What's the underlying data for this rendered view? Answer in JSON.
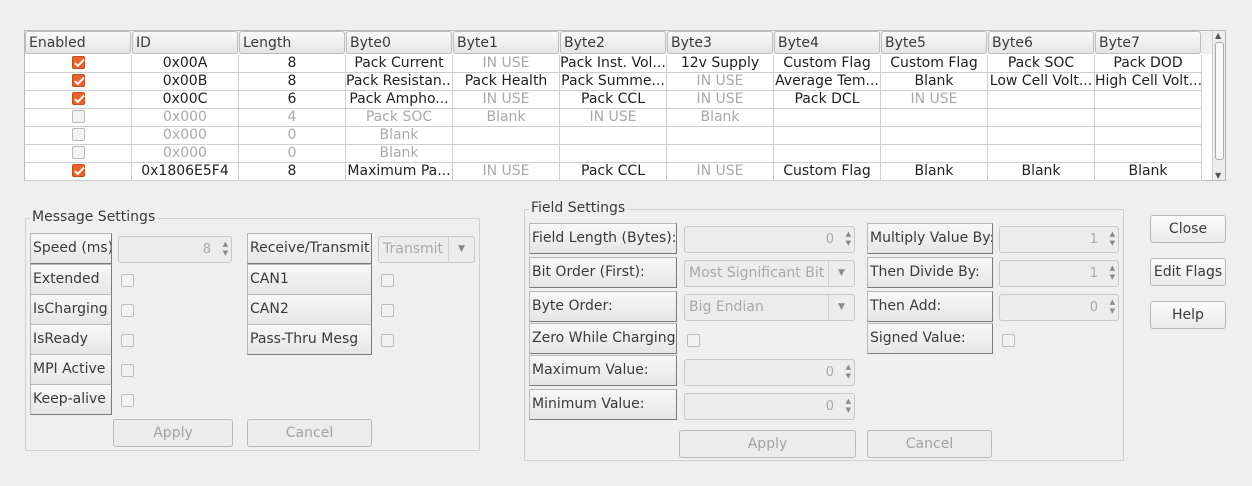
{
  "table": {
    "columns": [
      {
        "label": "Enabled"
      },
      {
        "label": "ID"
      },
      {
        "label": "Length"
      },
      {
        "label": "Byte0"
      },
      {
        "label": "Byte1"
      },
      {
        "label": "Byte2"
      },
      {
        "label": "Byte3"
      },
      {
        "label": "Byte4"
      },
      {
        "label": "Byte5"
      },
      {
        "label": "Byte6"
      },
      {
        "label": "Byte7"
      }
    ],
    "rows": [
      {
        "enabled": true,
        "id": "0x00A",
        "length": "8",
        "bytes": [
          "Pack Current",
          "IN USE",
          "Pack Inst. Vol...",
          "12v Supply",
          "Custom Flag",
          "Custom Flag",
          "Pack SOC",
          "Pack DOD"
        ],
        "dim": [
          false,
          true,
          false,
          false,
          false,
          false,
          false,
          false
        ]
      },
      {
        "enabled": true,
        "id": "0x00B",
        "length": "8",
        "bytes": [
          "Pack Resistan...",
          "Pack Health",
          "Pack Summe...",
          "IN USE",
          "Average Tem...",
          "Blank",
          "Low Cell Volt...",
          "High Cell Volt..."
        ],
        "dim": [
          false,
          false,
          false,
          true,
          false,
          false,
          false,
          false
        ]
      },
      {
        "enabled": true,
        "id": "0x00C",
        "length": "6",
        "bytes": [
          "Pack Ampho...",
          "IN USE",
          "Pack CCL",
          "IN USE",
          "Pack DCL",
          "IN USE",
          "",
          ""
        ],
        "dim": [
          false,
          true,
          false,
          true,
          false,
          true,
          false,
          false
        ]
      },
      {
        "enabled": false,
        "id": "0x000",
        "length": "4",
        "bytes": [
          "Pack SOC",
          "Blank",
          "IN USE",
          "Blank",
          "",
          "",
          "",
          ""
        ],
        "dim": [
          true,
          true,
          true,
          true,
          true,
          true,
          true,
          true
        ]
      },
      {
        "enabled": false,
        "id": "0x000",
        "length": "0",
        "bytes": [
          "Blank",
          "",
          "",
          "",
          "",
          "",
          "",
          ""
        ],
        "dim": [
          true,
          true,
          true,
          true,
          true,
          true,
          true,
          true
        ]
      },
      {
        "enabled": false,
        "id": "0x000",
        "length": "0",
        "bytes": [
          "Blank",
          "",
          "",
          "",
          "",
          "",
          "",
          ""
        ],
        "dim": [
          true,
          true,
          true,
          true,
          true,
          true,
          true,
          true
        ]
      },
      {
        "enabled": true,
        "id": "0x1806E5F4",
        "length": "8",
        "bytes": [
          "Maximum Pa...",
          "IN USE",
          "Pack CCL",
          "IN USE",
          "Custom Flag",
          "Blank",
          "Blank",
          "Blank"
        ],
        "dim": [
          false,
          true,
          false,
          true,
          false,
          false,
          false,
          false
        ]
      }
    ]
  },
  "message_settings": {
    "title": "Message Settings",
    "speed_label": "Speed (ms)",
    "speed_value": "8",
    "extended_label": "Extended",
    "ischarging_label": "IsCharging",
    "isready_label": "IsReady",
    "mpi_active_label": "MPI Active",
    "keep_alive_label": "Keep-alive",
    "receive_transmit_label": "Receive/Transmit",
    "receive_transmit_value": "Transmit",
    "can1_label": "CAN1",
    "can2_label": "CAN2",
    "pass_thru_label": "Pass-Thru Mesg",
    "apply_label": "Apply",
    "cancel_label": "Cancel"
  },
  "field_settings": {
    "title": "Field Settings",
    "field_length_label": "Field Length (Bytes):",
    "field_length_value": "0",
    "bit_order_label": "Bit Order (First):",
    "bit_order_value": "Most Significant Bit",
    "byte_order_label": "Byte Order:",
    "byte_order_value": "Big Endian",
    "zero_while_charging_label": "Zero While Charging:",
    "maximum_value_label": "Maximum Value:",
    "maximum_value": "0",
    "minimum_value_label": "Minimum Value:",
    "minimum_value": "0",
    "multiply_label": "Multiply Value By:",
    "multiply_value": "1",
    "divide_label": "Then Divide By:",
    "divide_value": "1",
    "add_label": "Then Add:",
    "add_value": "0",
    "signed_label": "Signed Value:",
    "apply_label": "Apply",
    "cancel_label": "Cancel"
  },
  "side_buttons": {
    "close_label": "Close",
    "edit_flags_label": "Edit Flags",
    "help_label": "Help"
  },
  "colors": {
    "checkbox_checked": "#e8622d"
  }
}
